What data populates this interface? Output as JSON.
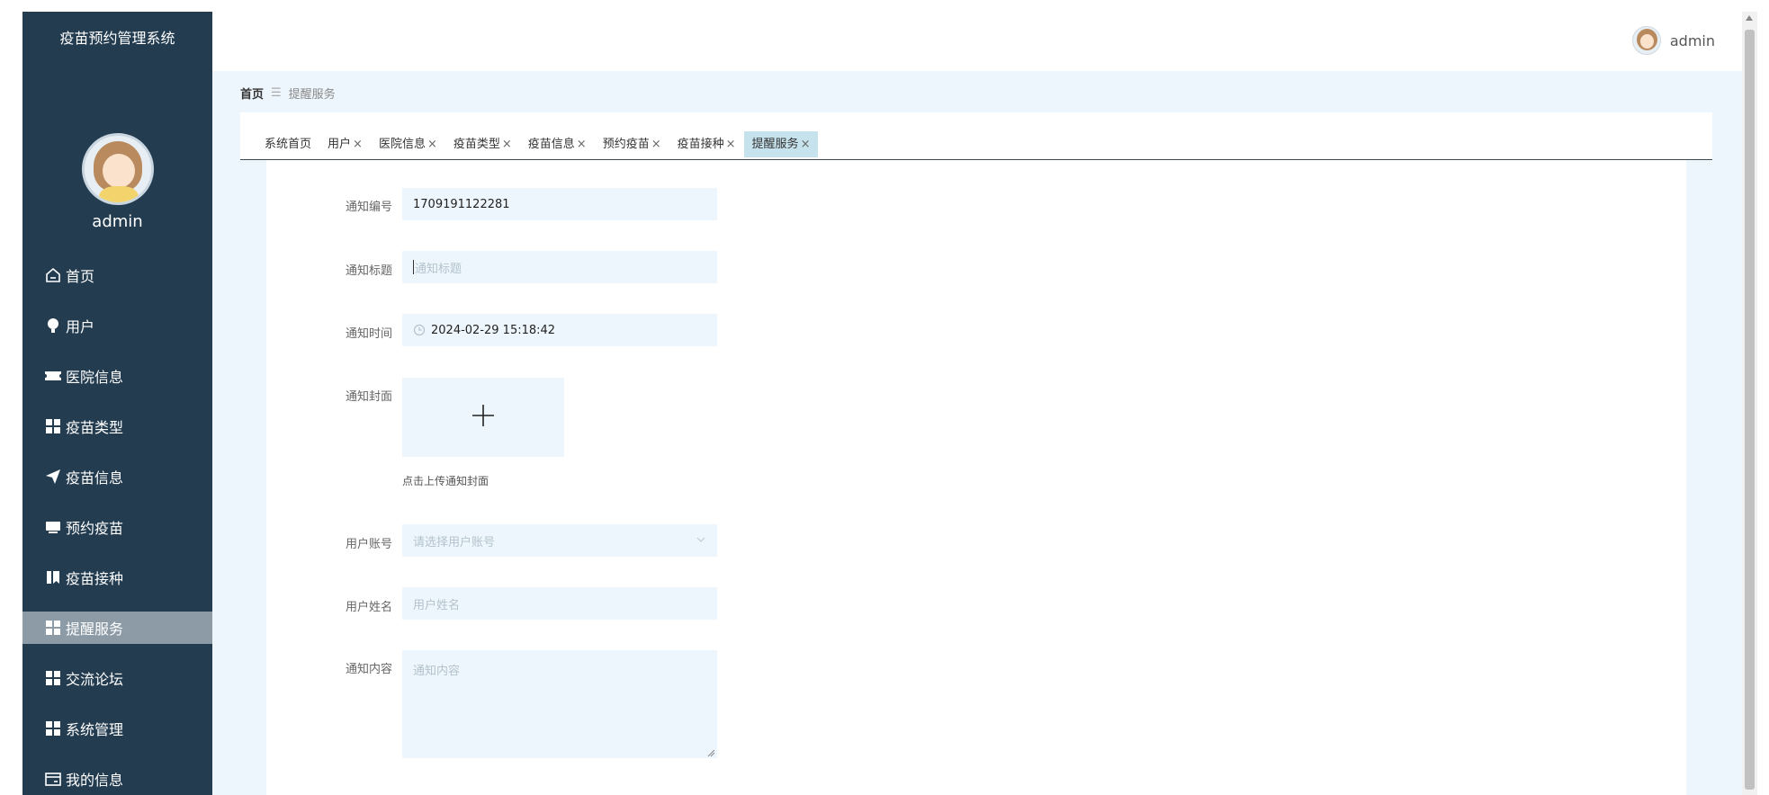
{
  "app": {
    "title": "疫苗预约管理系统"
  },
  "header": {
    "username": "admin"
  },
  "sidebar": {
    "username": "admin",
    "items": [
      {
        "label": "首页",
        "icon": "home-icon"
      },
      {
        "label": "用户",
        "icon": "bulb-icon"
      },
      {
        "label": "医院信息",
        "icon": "ticket-icon"
      },
      {
        "label": "疫苗类型",
        "icon": "grid-icon"
      },
      {
        "label": "疫苗信息",
        "icon": "send-icon"
      },
      {
        "label": "预约疫苗",
        "icon": "monitor-icon"
      },
      {
        "label": "疫苗接种",
        "icon": "book-icon"
      },
      {
        "label": "提醒服务",
        "icon": "grid-icon",
        "active": true
      },
      {
        "label": "交流论坛",
        "icon": "grid-icon"
      },
      {
        "label": "系统管理",
        "icon": "grid-icon"
      },
      {
        "label": "我的信息",
        "icon": "card-icon"
      }
    ]
  },
  "breadcrumb": {
    "home": "首页",
    "separator": "☰",
    "current": "提醒服务"
  },
  "tabs": [
    {
      "label": "系统首页",
      "closable": false
    },
    {
      "label": "用户",
      "closable": true
    },
    {
      "label": "医院信息",
      "closable": true
    },
    {
      "label": "疫苗类型",
      "closable": true
    },
    {
      "label": "疫苗信息",
      "closable": true
    },
    {
      "label": "预约疫苗",
      "closable": true
    },
    {
      "label": "疫苗接种",
      "closable": true
    },
    {
      "label": "提醒服务",
      "closable": true,
      "active": true
    }
  ],
  "tab_close_glyph": "×",
  "form": {
    "notice_no": {
      "label": "通知编号",
      "value": "1709191122281"
    },
    "notice_title": {
      "label": "通知标题",
      "placeholder": "通知标题"
    },
    "notice_time": {
      "label": "通知时间",
      "value": "2024-02-29 15:18:42"
    },
    "notice_cover": {
      "label": "通知封面",
      "upload_tip": "点击上传通知封面"
    },
    "user_account": {
      "label": "用户账号",
      "placeholder": "请选择用户账号"
    },
    "user_name": {
      "label": "用户姓名",
      "placeholder": "用户姓名"
    },
    "notice_content": {
      "label": "通知内容",
      "placeholder": "通知内容"
    }
  },
  "colors": {
    "sidebar_bg": "#233c50",
    "active_menu": "#8c9ba6",
    "active_tab": "#c6e2ec",
    "input_bg": "#edf6fc",
    "main_bg": "#eef6fd"
  }
}
